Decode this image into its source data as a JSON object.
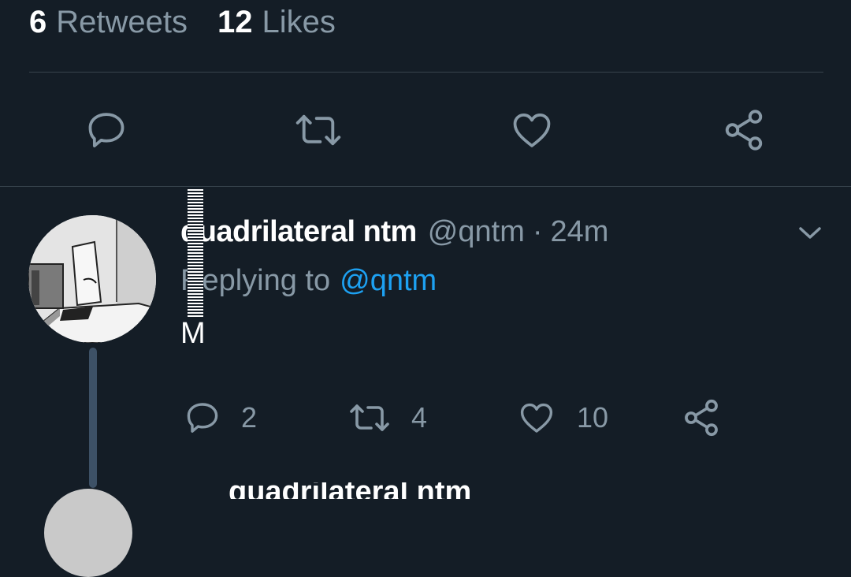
{
  "stats": {
    "retweets_count": "6",
    "retweets_label": "Retweets",
    "likes_count": "12",
    "likes_label": "Likes"
  },
  "main_actions": [
    "reply-icon",
    "retweet-icon",
    "like-icon",
    "share-icon"
  ],
  "reply": {
    "name": "quadrilateral ntm",
    "handle": "@qntm",
    "separator": "·",
    "time": "24m",
    "replying_label": "Replying to",
    "replying_handle": "@qntm",
    "text": "M",
    "reply_count": "2",
    "retweet_count": "4",
    "like_count": "10"
  },
  "colors": {
    "background": "#141d26",
    "secondary_text": "#8899a6",
    "link": "#1da1f2",
    "divider": "#38444d",
    "thread_line": "#3d5166"
  }
}
